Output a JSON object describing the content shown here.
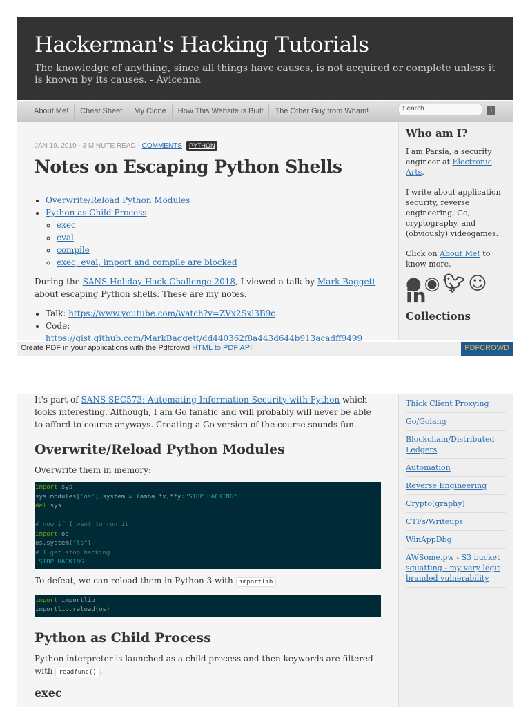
{
  "header": {
    "title": "Hackerman's Hacking Tutorials",
    "tagline": "The knowledge of anything, since all things have causes, is not acquired or complete unless it is known by its causes. - Avicenna"
  },
  "nav": {
    "items": [
      "About Me!",
      "Cheat Sheet",
      "My Clone",
      "How This Website is Built",
      "The Other Guy from Wham!"
    ],
    "search_placeholder": "Search"
  },
  "post": {
    "date": "JAN 19, 2019 - 3 MINUTE READ - ",
    "comments": "COMMENTS",
    "tag": "PYTHON",
    "title": "Notes on Escaping Python Shells",
    "toc": [
      "Overwrite/Reload Python Modules",
      "Python as Child Process",
      "exec",
      "eval",
      "compile",
      "exec, eval, import and compile are blocked"
    ],
    "intro_a": "During the ",
    "intro_link1": "SANS Holiday Hack Challenge 2018",
    "intro_b": ", I viewed a talk by ",
    "intro_link2": "Mark Baggett",
    "intro_c": " about escaping Python shells. These are my notes.",
    "talk_label": "Talk: ",
    "talk_url": "https://www.youtube.com/watch?v=ZVx2Sxl3B9c",
    "code_label": "Code: ",
    "code_url": "https://gist.github.com/MarkBaggett/dd440362f8a443d644b913acadff9499",
    "p2_a": "It's part of ",
    "p2_link": "SANS SEC573: Automating Information Security with Python",
    "p2_b": " which looks interesting. Although, I am Go fanatic and will probably will never be able to afford to course anyways. Creating a Go version of the course sounds fun.",
    "h_overwrite": "Overwrite/Reload Python Modules",
    "p_overwrite": "Overwrite them in memory:",
    "p_defeat": "To defeat, we can reload them in Python 3 with ",
    "importlib": "importlib",
    "h_child": "Python as Child Process",
    "p_child": "Python interpreter is launched as a child process and then keywords are filtered with ",
    "readfunc": "readfunc()",
    "period": ".",
    "h_exec": "exec"
  },
  "code1": {
    "l1k": "import",
    "l1": " sys",
    "l2a": "sys.modules[",
    "l2s": "'os'",
    "l2b": "].system = lamba *x,**y:",
    "l2s2": "\"STOP HACKING\"",
    "l3k": "del",
    "l3": " sys",
    "l5": "# now if I want to run it",
    "l6k": "import",
    "l6": " os",
    "l7a": "os.system(",
    "l7s": "\"ls\"",
    "l7b": ")",
    "l8": "# I get stop hacking",
    "l9": "'STOP HACKING'"
  },
  "code2": {
    "l1k": "import",
    "l1": " importlib",
    "l2": "importlib.reload(os)"
  },
  "sidebar": {
    "who_title": "Who am I?",
    "p1_a": "I am Parsia, a security engineer at ",
    "p1_link": "Electronic Arts",
    "p1_b": ".",
    "p2": "I write about application security, reverse engineering, Go, cryptography, and (obviously) videogames.",
    "p3_a": "Click on ",
    "p3_link": "About Me!",
    "p3_b": " to know more.",
    "social": [
      "github-icon",
      "bitbucket-icon",
      "twitter-icon",
      "keybase-icon",
      "linkedin-icon"
    ],
    "linkedin_text": "in",
    "collections_title": "Collections",
    "collections": [
      "Thick Client Proxying",
      "Go/Golang",
      "Blockchain/Distributed Ledgers",
      "Automation",
      "Reverse Engineering",
      "Crypto(graphy)",
      "CTFs/Writeups",
      "WinAppDbg",
      "AWSome.pw - S3 bucket squatting - my very legit branded vulnerability"
    ]
  },
  "pdf": {
    "text": "Create PDF in your applications with the Pdfcrowd ",
    "link": "HTML to PDF API",
    "button": "PDFCROWD"
  }
}
